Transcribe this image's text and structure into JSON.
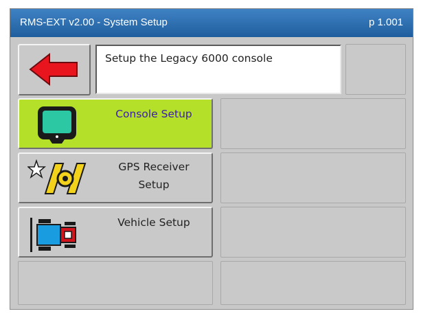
{
  "header": {
    "title": "RMS-EXT v2.00 - System Setup",
    "page": "p 1.001"
  },
  "message": "Setup the Legacy 6000 console",
  "menu": [
    {
      "label": "Console Setup",
      "icon": "console-icon",
      "selected": true
    },
    {
      "label_line1": "GPS Receiver",
      "label_line2": "Setup",
      "icon": "gps-receiver-icon",
      "selected": false
    },
    {
      "label": "Vehicle Setup",
      "icon": "vehicle-icon",
      "selected": false
    }
  ],
  "colors": {
    "title_bar": "#2a6db0",
    "selected_button": "#b4e02a",
    "back_arrow": "#e8141e",
    "screen_bg": "#c8c8c8"
  }
}
